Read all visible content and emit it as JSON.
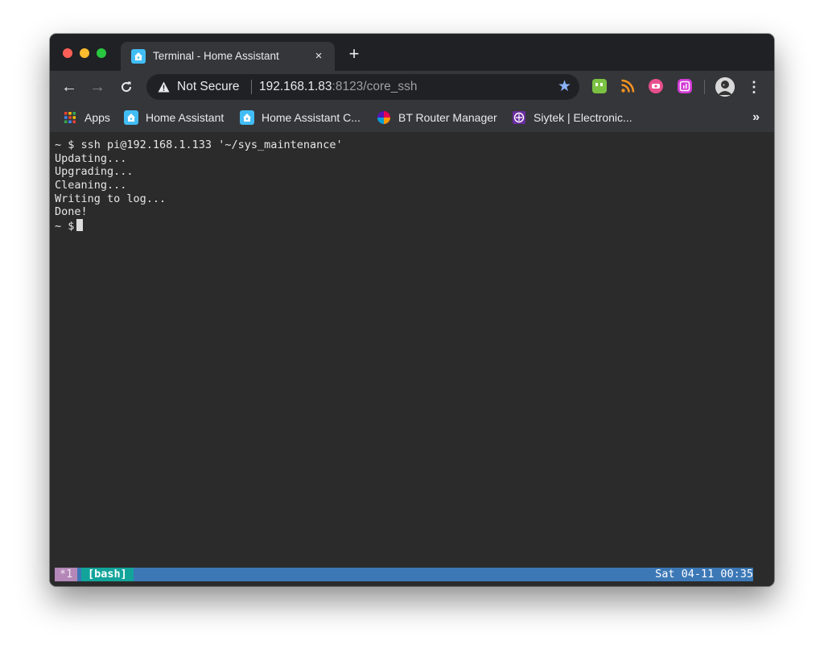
{
  "browser": {
    "tab": {
      "title": "Terminal - Home Assistant",
      "close_glyph": "×"
    },
    "new_tab_glyph": "+",
    "nav": {
      "back_glyph": "←",
      "forward_glyph": "→",
      "reload_glyph": "C"
    },
    "omnibox": {
      "security_label": "Not Secure",
      "url_host": "192.168.1.83",
      "url_rest": ":8123/core_ssh",
      "bookmark_star_glyph": "★"
    },
    "extensions": [
      "hangouts-icon",
      "rss-icon",
      "screen-recorder-icon",
      "analytics-icon"
    ],
    "menu_glyph": "⋮"
  },
  "bookmarks": {
    "items": [
      {
        "label": "Apps",
        "icon": "apps-grid-icon"
      },
      {
        "label": "Home Assistant",
        "icon": "home-assistant-icon"
      },
      {
        "label": "Home Assistant C...",
        "icon": "home-assistant-icon"
      },
      {
        "label": "BT Router Manager",
        "icon": "bt-icon"
      },
      {
        "label": "Siytek | Electronic...",
        "icon": "siytek-icon"
      }
    ],
    "overflow_glyph": "»"
  },
  "terminal": {
    "lines": [
      "~ $ ssh pi@192.168.1.133 '~/sys_maintenance'",
      "Updating...",
      "Upgrading...",
      "Cleaning...",
      "Writing to log...",
      "Done!"
    ],
    "prompt": "~ $",
    "statusbar": {
      "window_index": "*1",
      "window_name": "[bash]",
      "clock": "Sat 04-11 00:35"
    }
  },
  "colors": {
    "traffic_red": "#ff5f57",
    "traffic_yellow": "#febc2e",
    "traffic_green": "#28c840",
    "terminal_bg": "#2b2b2b",
    "statusbar_bg": "#3c78b6",
    "statusbar_bash": "#12a49a",
    "statusbar_window": "#b487b8",
    "ha_blue": "#41bdf5"
  }
}
